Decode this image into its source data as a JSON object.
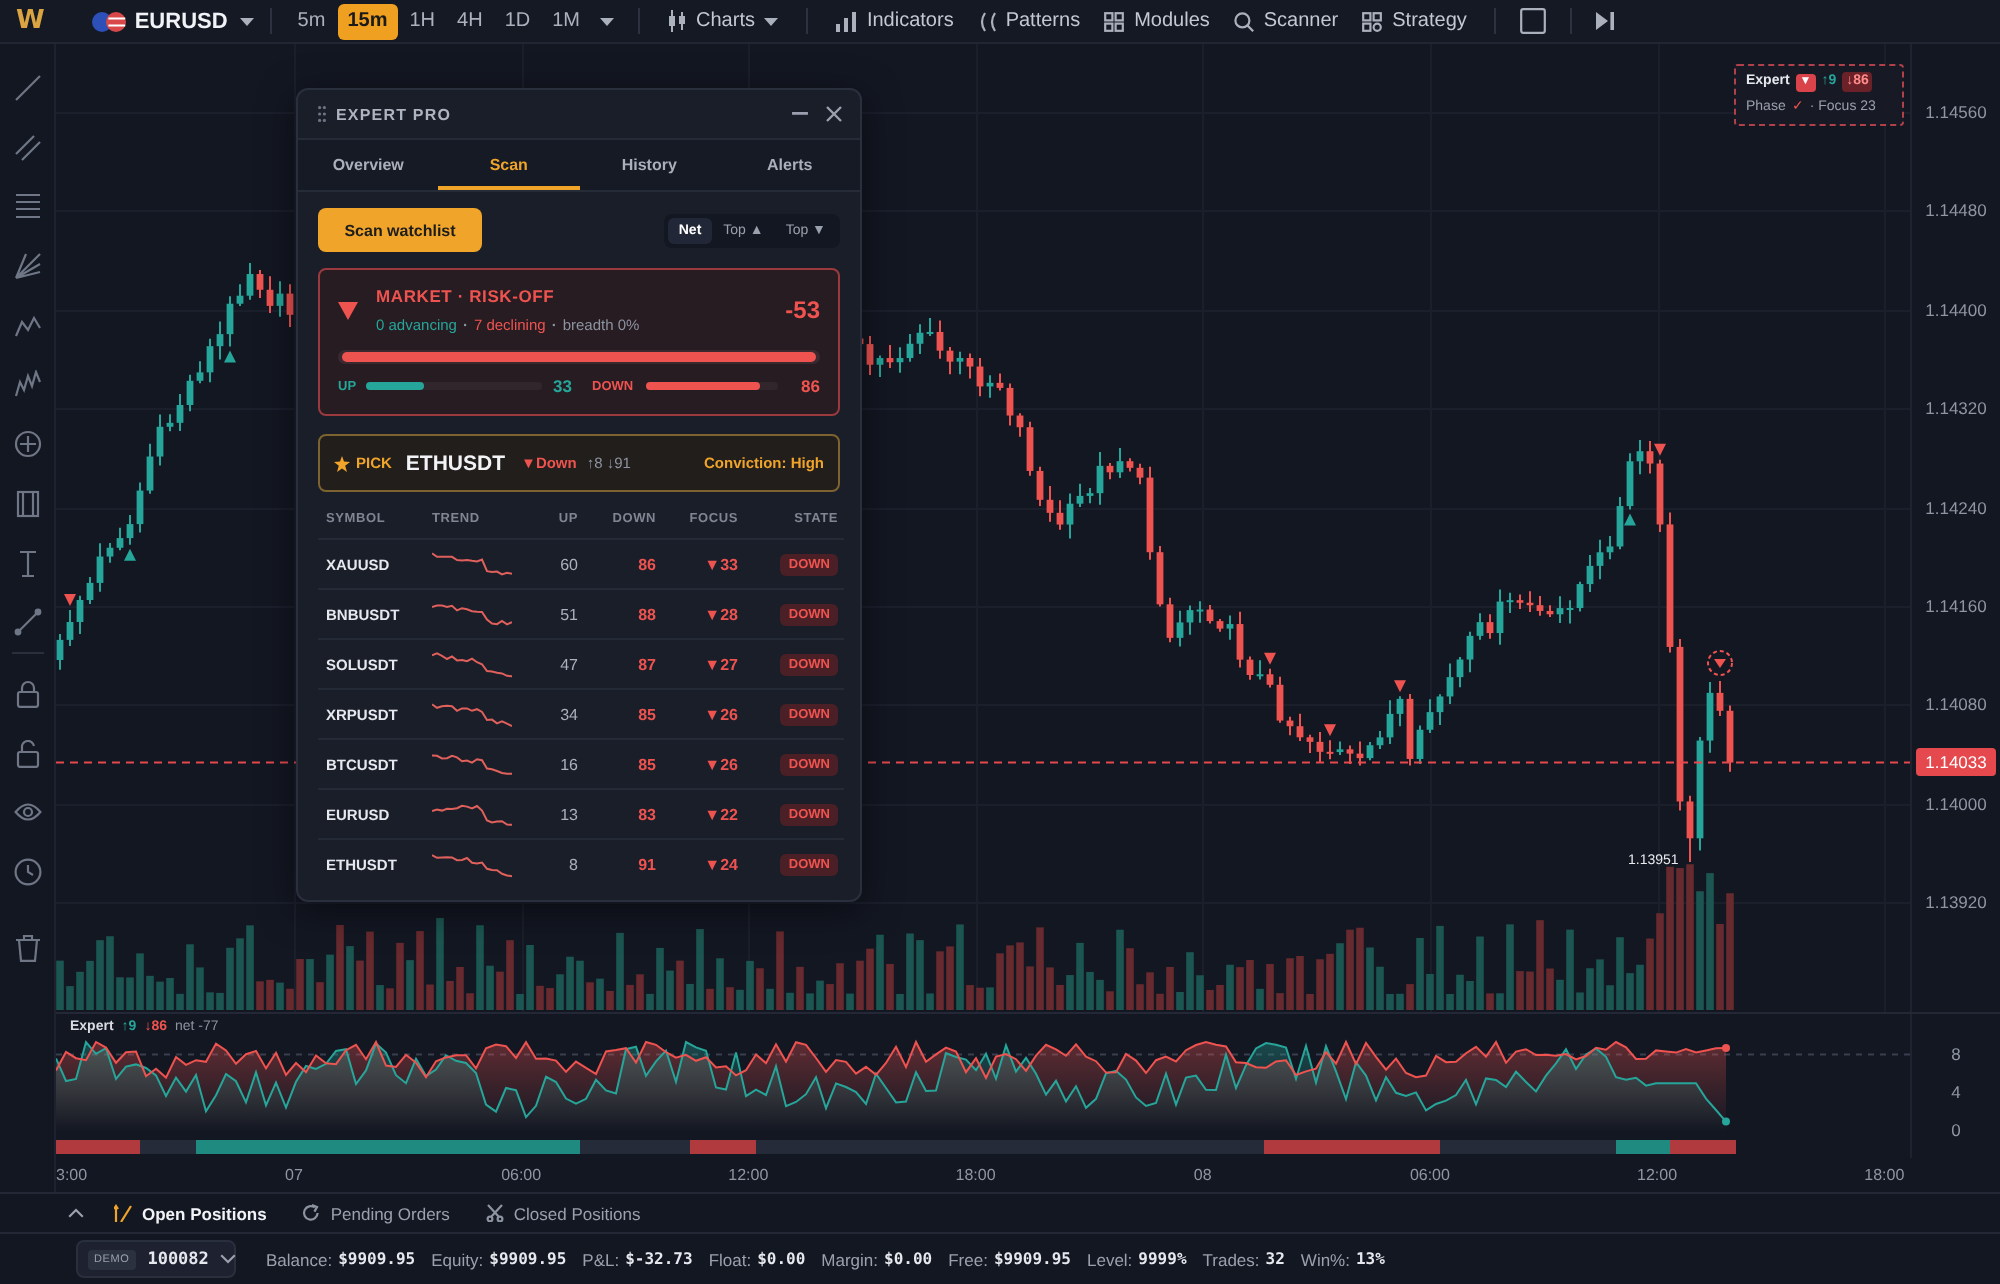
{
  "toolbar": {
    "logo": "W",
    "symbol": "EURUSD",
    "timeframes": [
      {
        "label": "5m",
        "selected": false
      },
      {
        "label": "15m",
        "selected": true
      },
      {
        "label": "1H",
        "selected": false
      },
      {
        "label": "4H",
        "selected": false
      },
      {
        "label": "1D",
        "selected": false
      },
      {
        "label": "1M",
        "selected": false
      }
    ],
    "menus": [
      {
        "label": "Charts",
        "dropdown": true
      },
      {
        "label": "Indicators",
        "dropdown": false
      },
      {
        "label": "Patterns",
        "dropdown": false
      },
      {
        "label": "Modules",
        "dropdown": false
      },
      {
        "label": "Scanner",
        "dropdown": false
      },
      {
        "label": "Strategy",
        "dropdown": false
      }
    ]
  },
  "chart": {
    "price_axis": [
      "1.14560",
      "1.14480",
      "1.14400",
      "1.14320",
      "1.14240",
      "1.14160",
      "1.14080",
      "1.14000",
      "1.13920"
    ],
    "last_price": "1.14033",
    "low_label": "1.13951",
    "expert_tag": {
      "label": "Expert",
      "signal": "▼",
      "up": "↑9",
      "down": "↓86",
      "phase": "Phase",
      "phase_mark": "✓",
      "focus": "· Focus 23"
    }
  },
  "expert_panel": {
    "title": "EXPERT PRO",
    "tabs": [
      {
        "label": "Overview",
        "selected": false
      },
      {
        "label": "Scan",
        "selected": true
      },
      {
        "label": "History",
        "selected": false
      },
      {
        "label": "Alerts",
        "selected": false
      }
    ],
    "scan_button": "Scan watchlist",
    "filters": [
      {
        "label": "Net",
        "selected": true
      },
      {
        "label": "Top ▲",
        "selected": false
      },
      {
        "label": "Top ▼",
        "selected": false
      }
    ],
    "market": {
      "title": "MARKET · RISK-OFF",
      "summary": [
        {
          "text": "0 advancing",
          "color": "#26a69a"
        },
        {
          "text": "7 declining",
          "color": "#ef5350"
        },
        {
          "text": "breadth 0%",
          "color": "#8d93a0"
        }
      ],
      "separators": [
        "·",
        "·"
      ],
      "score": "-53",
      "net_bar": {
        "level": 1
      },
      "up": {
        "label": "UP",
        "level": 0.33,
        "value": "33"
      },
      "down": {
        "label": "DOWN",
        "level": 0.86,
        "value": "86"
      }
    },
    "pick": {
      "label": "PICK",
      "symbol": "ETHUSDT",
      "direction": "▼Down",
      "votes": "↑8 ↓91",
      "conviction": "Conviction: High"
    },
    "table": {
      "columns": [
        "SYMBOL",
        "TREND",
        "UP",
        "DOWN",
        "FOCUS",
        "STATE"
      ],
      "rows": [
        {
          "symbol": "XAUUSD",
          "up": "60",
          "down": "86",
          "focus": "▼33",
          "state": "DOWN"
        },
        {
          "symbol": "BNBUSDT",
          "up": "51",
          "down": "88",
          "focus": "▼28",
          "state": "DOWN"
        },
        {
          "symbol": "SOLUSDT",
          "up": "47",
          "down": "87",
          "focus": "▼27",
          "state": "DOWN"
        },
        {
          "symbol": "XRPUSDT",
          "up": "34",
          "down": "85",
          "focus": "▼26",
          "state": "DOWN"
        },
        {
          "symbol": "BTCUSDT",
          "up": "16",
          "down": "85",
          "focus": "▼26",
          "state": "DOWN"
        },
        {
          "symbol": "EURUSD",
          "up": "13",
          "down": "83",
          "focus": "▼22",
          "state": "DOWN"
        },
        {
          "symbol": "ETHUSDT",
          "up": "8",
          "down": "91",
          "focus": "▼24",
          "state": "DOWN"
        }
      ]
    }
  },
  "oscillator": {
    "label": "Expert",
    "up": "↑9",
    "down": "↓86",
    "net": "net -77",
    "axis": [
      "8",
      "4",
      "0"
    ]
  },
  "time_axis": [
    "3:00",
    "07",
    "06:00",
    "12:00",
    "18:00",
    "08",
    "06:00",
    "12:00",
    "18:00"
  ],
  "positions_tabs": [
    {
      "label": "Open Positions",
      "selected": true
    },
    {
      "label": "Pending Orders",
      "selected": false
    },
    {
      "label": "Closed Positions",
      "selected": false
    }
  ],
  "status_bar": {
    "account": {
      "badge": "DEMO",
      "number": "100082"
    },
    "stats": [
      {
        "label": "Balance:",
        "value": "$9909.95"
      },
      {
        "label": "Equity:",
        "value": "$9909.95"
      },
      {
        "label": "P&L:",
        "value": "$-32.73"
      },
      {
        "label": "Float:",
        "value": "$0.00"
      },
      {
        "label": "Margin:",
        "value": "$0.00"
      },
      {
        "label": "Free:",
        "value": "$9909.95"
      },
      {
        "label": "Level:",
        "value": "9999%"
      },
      {
        "label": "Trades:",
        "value": "32"
      },
      {
        "label": "Win%:",
        "value": "13%"
      }
    ]
  }
}
